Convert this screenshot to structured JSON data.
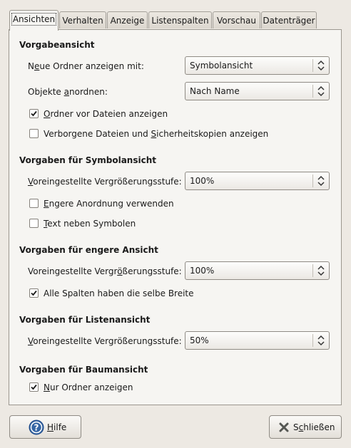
{
  "tabs": [
    "Ansichten",
    "Verhalten",
    "Anzeige",
    "Listenspalten",
    "Vorschau",
    "Datenträger"
  ],
  "active_tab": "Ansichten",
  "default_view": {
    "title": "Vorgabeansicht",
    "new_folders_label_pre": "N",
    "new_folders_label_u": "e",
    "new_folders_label_post": "ue Ordner anzeigen mit:",
    "new_folders_value": "Symbolansicht",
    "arrange_label_pre": "Objekte ",
    "arrange_label_u": "a",
    "arrange_label_post": "nordnen:",
    "arrange_value": "Nach Name",
    "folders_first_u": "O",
    "folders_first_post": "rdner vor Dateien anzeigen",
    "folders_first_checked": true,
    "hidden_pre": "Verborgene Dateien und ",
    "hidden_u": "S",
    "hidden_post": "icherheitskopien anzeigen",
    "hidden_checked": false
  },
  "icon_view": {
    "title": "Vorgaben für Symbolansicht",
    "zoom_label_u": "V",
    "zoom_label_post": "oreingestellte Vergrößerungsstufe:",
    "zoom_value": "100%",
    "compact_u": "E",
    "compact_post": "ngere Anordnung verwenden",
    "compact_checked": false,
    "text_beside_u": "T",
    "text_beside_post": "ext neben Symbolen",
    "text_beside_checked": false
  },
  "compact_view": {
    "title": "Vorgaben für engere Ansicht",
    "zoom_label_pre": "Voreingestellte Vergr",
    "zoom_label_u": "ö",
    "zoom_label_post": "ßerungsstufe:",
    "zoom_value": "100%",
    "same_width_label": "Alle Spalten haben die selbe Breite",
    "same_width_checked": true
  },
  "list_view": {
    "title": "Vorgaben für Listenansicht",
    "zoom_label_u": "V",
    "zoom_label_post": "oreingestellte Vergrößerungsstufe:",
    "zoom_value": "50%"
  },
  "tree_view": {
    "title": "Vorgaben für Baumansicht",
    "only_folders_u": "N",
    "only_folders_post": "ur Ordner anzeigen",
    "only_folders_checked": true
  },
  "buttons": {
    "help_u": "H",
    "help_post": "ilfe",
    "close_pre": "S",
    "close_u": "c",
    "close_post": "hließen"
  },
  "colors": {
    "window_bg": "#ede9e3",
    "panel_bg": "#f6f5f2",
    "help_icon_blue": "#3465a4",
    "close_icon_gray": "#555753"
  }
}
